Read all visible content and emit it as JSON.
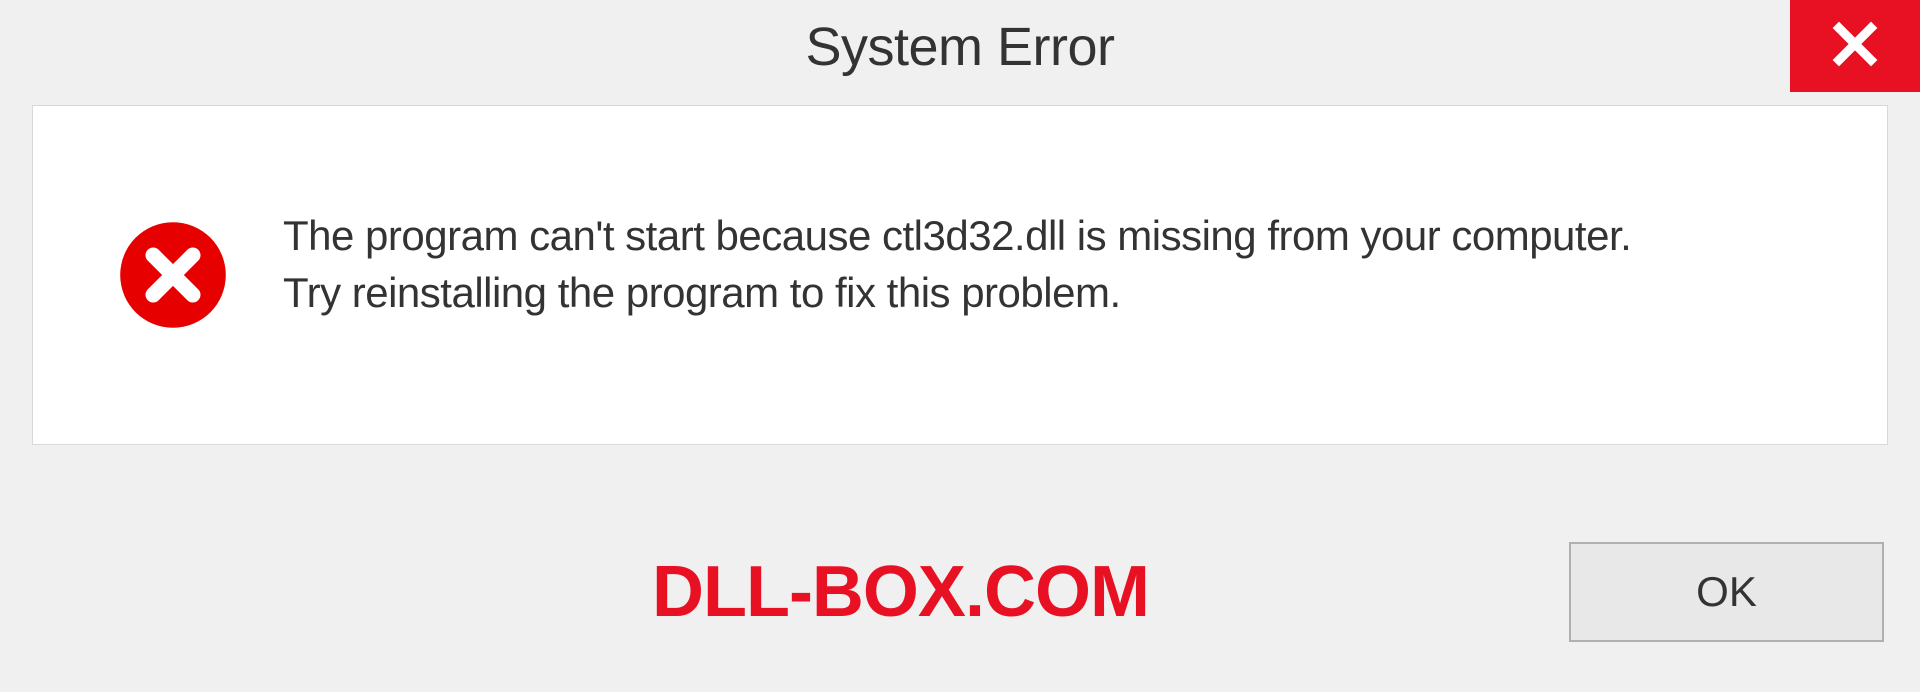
{
  "dialog": {
    "title": "System Error",
    "message_line1": "The program can't start because ctl3d32.dll is missing from your computer.",
    "message_line2": "Try reinstalling the program to fix this problem.",
    "ok_label": "OK"
  },
  "watermark": {
    "text": "DLL-BOX.COM"
  },
  "colors": {
    "close_red": "#e81123",
    "error_red": "#e60000",
    "watermark_red": "#e81123"
  }
}
